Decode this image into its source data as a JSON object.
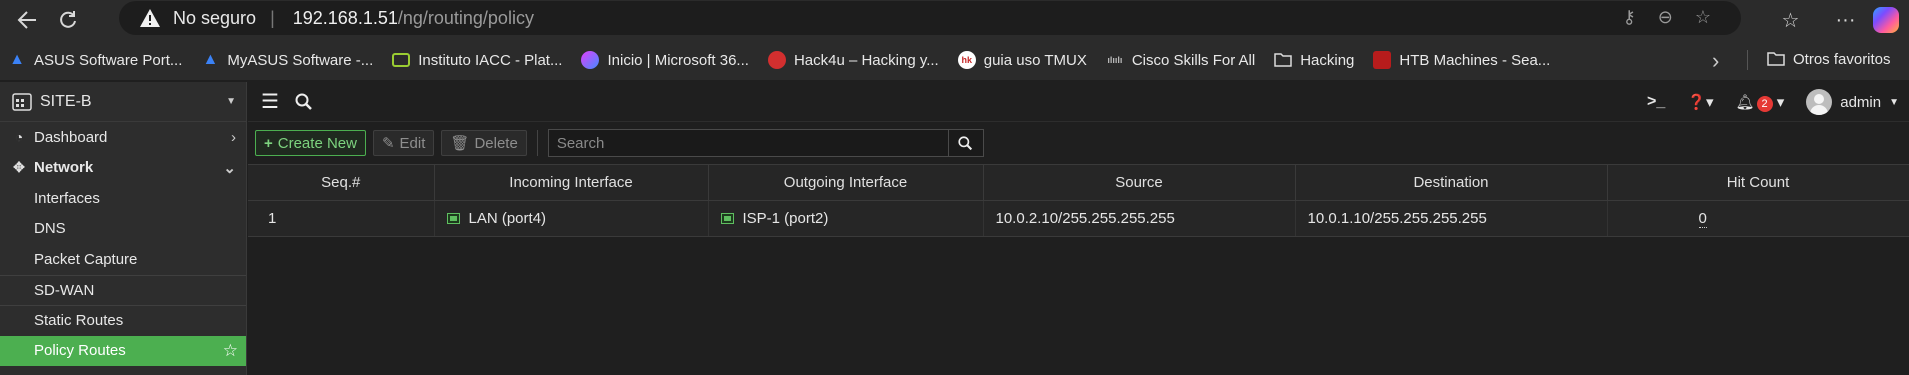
{
  "browser": {
    "security_label": "No seguro",
    "url_host": "192.168.1.51",
    "url_path": "/ng/routing/policy",
    "bookmarks": [
      {
        "label": "ASUS Software Port...",
        "icon": "asus-icon"
      },
      {
        "label": "MyASUS Software -...",
        "icon": "asus-icon"
      },
      {
        "label": "Instituto IACC - Plat...",
        "icon": "iacc-icon"
      },
      {
        "label": "Inicio | Microsoft 36...",
        "icon": "microsoft365-icon"
      },
      {
        "label": "Hack4u – Hacking y...",
        "icon": "hack4u-icon"
      },
      {
        "label": "guia uso TMUX",
        "icon": "tmux-icon"
      },
      {
        "label": "Cisco Skills For All",
        "icon": "cisco-icon"
      },
      {
        "label": "Hacking",
        "icon": "folder-icon"
      },
      {
        "label": "HTB Machines - Sea...",
        "icon": "htb-icon"
      }
    ],
    "other_bookmarks": "Otros favoritos"
  },
  "sidebar": {
    "device": "SITE-B",
    "items": [
      {
        "label": "Dashboard",
        "icon": "dashboard-icon"
      },
      {
        "label": "Network",
        "icon": "network-icon"
      },
      {
        "label": "Interfaces"
      },
      {
        "label": "DNS"
      },
      {
        "label": "Packet Capture"
      },
      {
        "label": "SD-WAN"
      },
      {
        "label": "Static Routes"
      },
      {
        "label": "Policy Routes"
      }
    ]
  },
  "topbar": {
    "notifications_count": "2",
    "user": "admin"
  },
  "toolbar": {
    "create_label": "Create New",
    "edit_label": "Edit",
    "delete_label": "Delete",
    "search_placeholder": "Search"
  },
  "table": {
    "columns": [
      "Seq.#",
      "Incoming Interface",
      "Outgoing Interface",
      "Source",
      "Destination",
      "Hit Count"
    ],
    "rows": [
      {
        "seq": "1",
        "incoming": "LAN (port4)",
        "outgoing": "ISP-1 (port2)",
        "source": "10.0.2.10/255.255.255.255",
        "destination": "10.0.1.10/255.255.255.255",
        "hits": "0"
      }
    ]
  },
  "colors": {
    "accent": "#4caf50",
    "badge": "#e53935"
  }
}
